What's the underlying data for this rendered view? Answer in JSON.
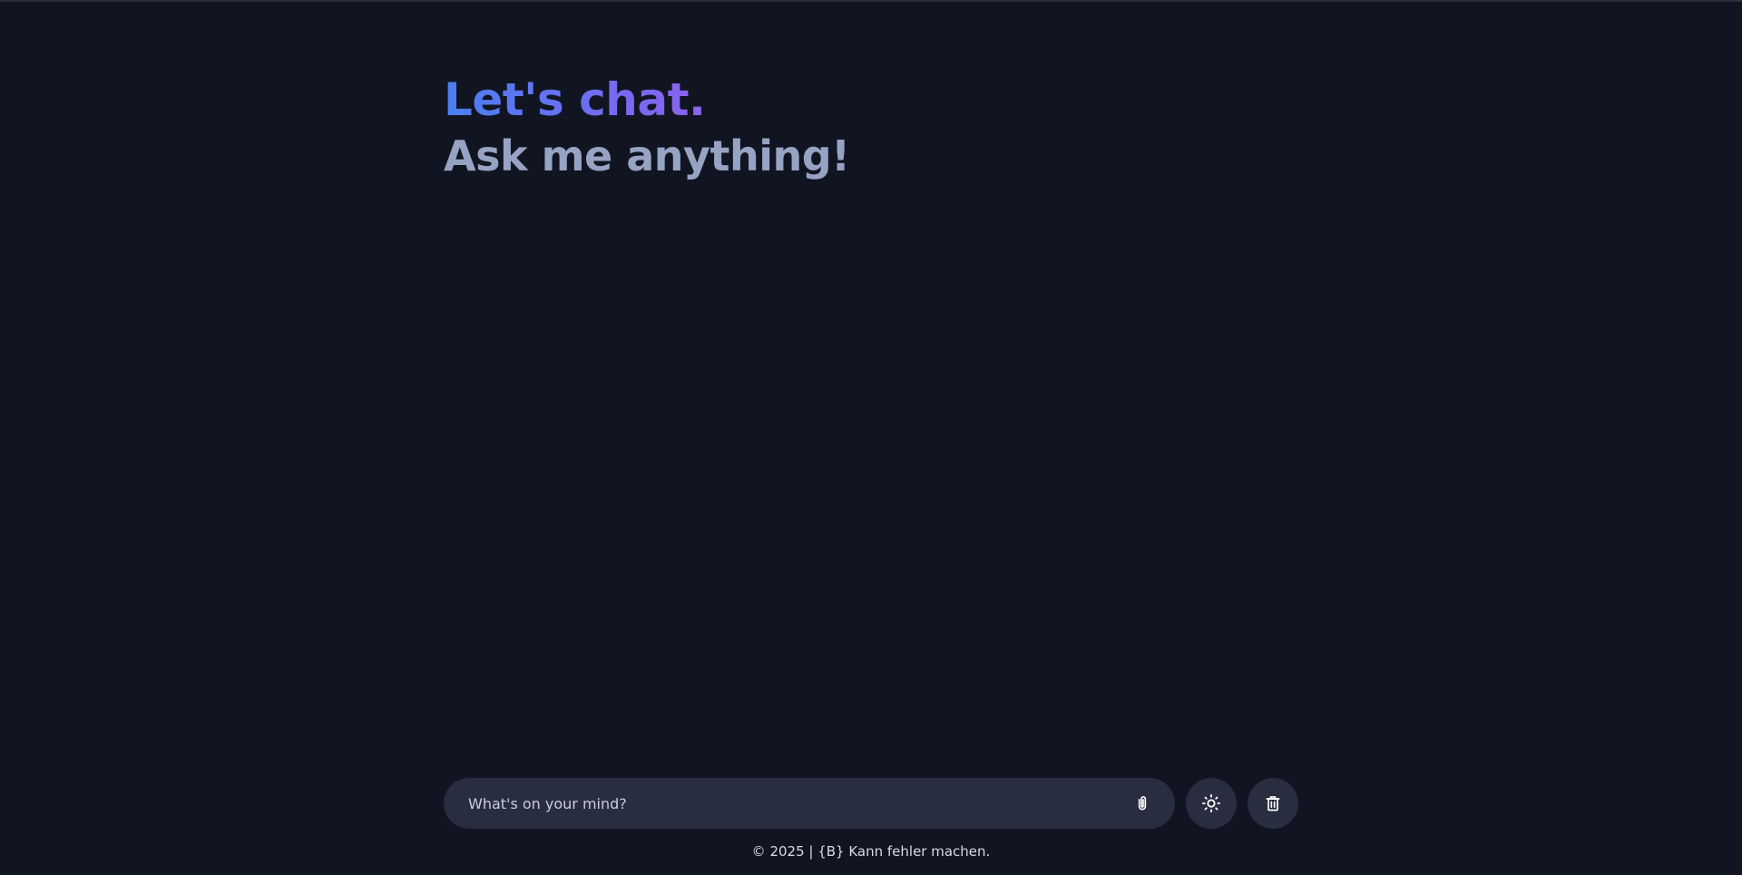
{
  "header": {
    "title": "Let's chat.",
    "subtitle": "Ask me anything!"
  },
  "composer": {
    "placeholder": "What's on your mind?",
    "value": "",
    "attach_icon": "paperclip-icon",
    "theme_icon": "sun-icon",
    "delete_icon": "trash-icon"
  },
  "footer": {
    "text": "© 2025 | {B} Kann fehler machen."
  },
  "colors": {
    "background": "#111522",
    "surface": "#282d40",
    "title_gradient_start": "#4a7ff0",
    "title_gradient_end": "#8c62ee",
    "subtitle": "#97a3c2",
    "text": "#d7dbe6"
  }
}
